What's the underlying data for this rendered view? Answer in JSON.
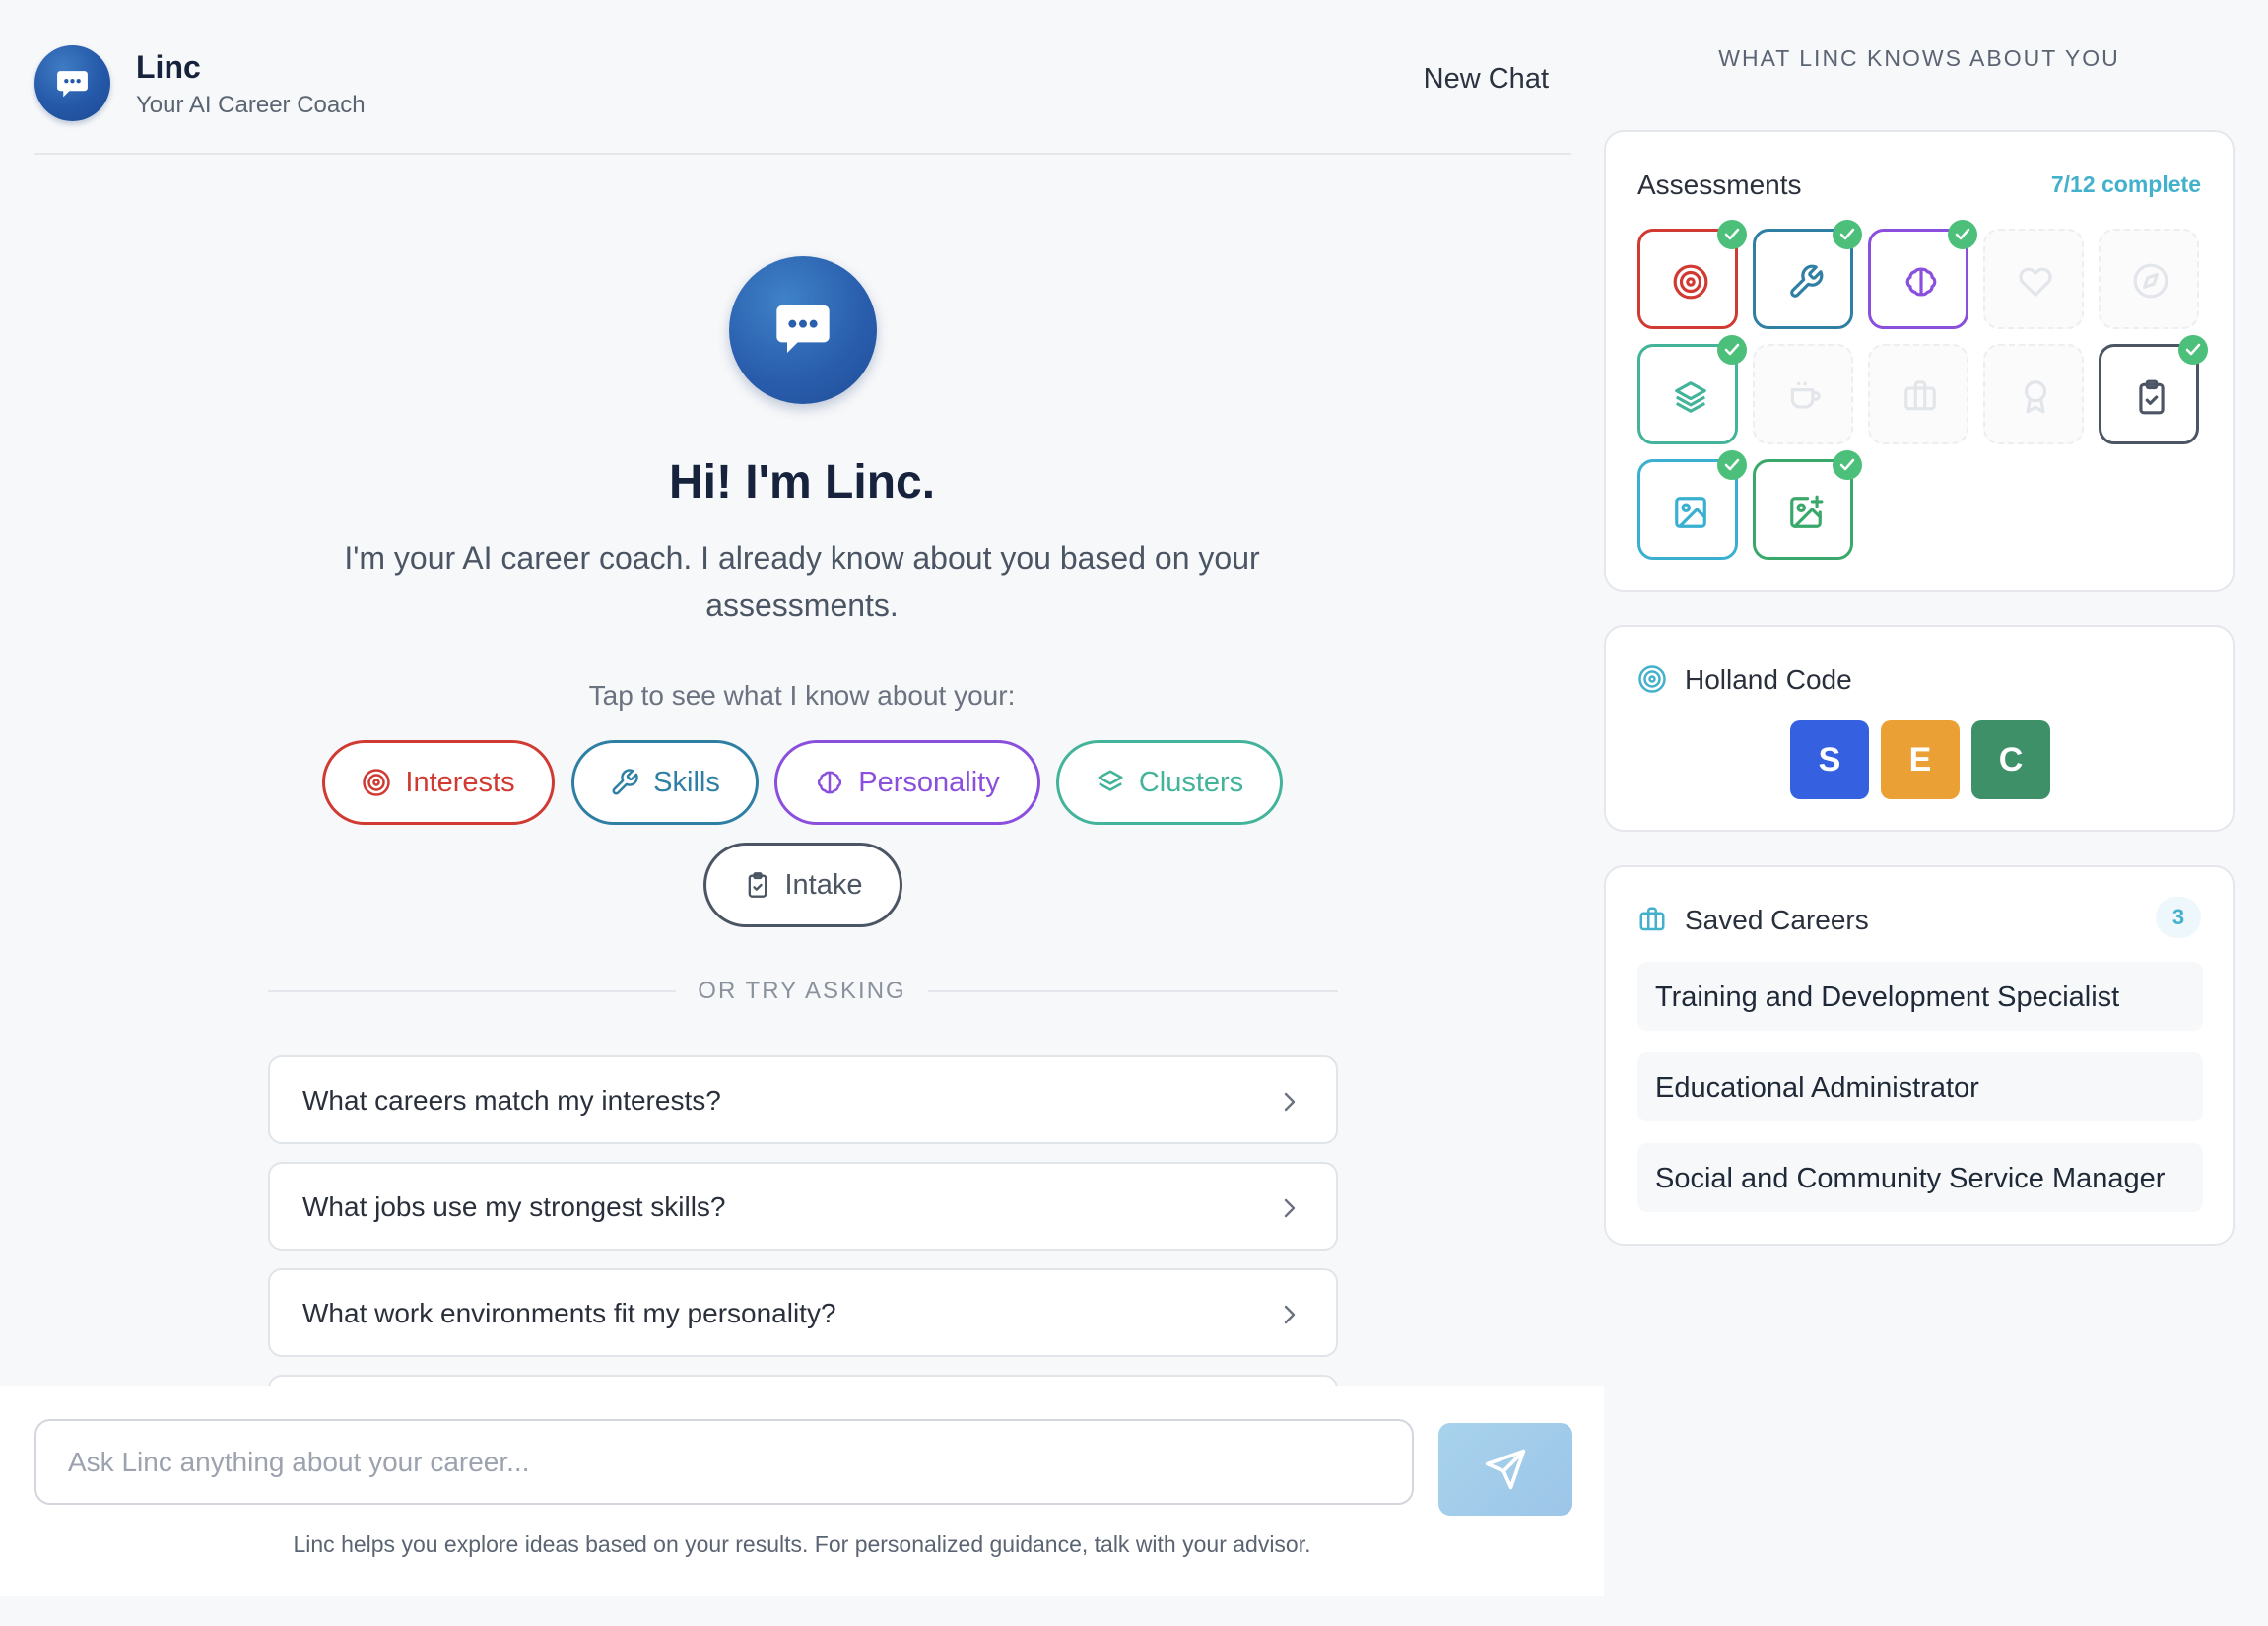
{
  "header": {
    "app_title": "Linc",
    "app_subtitle": "Your AI Career Coach",
    "new_chat_label": "New Chat"
  },
  "hero": {
    "title": "Hi! I'm Linc.",
    "intro": "I'm your AI career coach. I already know about you based on your assessments.",
    "tap_prompt": "Tap to see what I know about your:"
  },
  "topics": [
    {
      "label": "Interests",
      "icon": "target-icon",
      "color": "#d03a32"
    },
    {
      "label": "Skills",
      "icon": "wrench-icon",
      "color": "#2e7fa3"
    },
    {
      "label": "Personality",
      "icon": "brain-icon",
      "color": "#8a4fdc"
    },
    {
      "label": "Clusters",
      "icon": "layers-icon",
      "color": "#43b39a"
    },
    {
      "label": "Intake",
      "icon": "clipboard-check-icon",
      "color": "#4b5563"
    }
  ],
  "or_try_asking": "OR TRY ASKING",
  "suggestions": [
    "What careers match my interests?",
    "What jobs use my strongest skills?",
    "What work environments fit my personality?"
  ],
  "chat": {
    "placeholder": "Ask Linc anything about your career...",
    "send_icon": "send-icon",
    "disclaimer": "Linc helps you explore ideas based on your results. For personalized guidance, talk with your advisor."
  },
  "sidebar": {
    "heading": "WHAT LINC KNOWS ABOUT YOU",
    "assessments": {
      "title": "Assessments",
      "progress_text": "7/12 complete",
      "completed": 7,
      "total": 12,
      "tiles": [
        {
          "icon": "target-icon",
          "done": true,
          "color": "#d03a32"
        },
        {
          "icon": "wrench-icon",
          "done": true,
          "color": "#2e7fa3"
        },
        {
          "icon": "brain-icon",
          "done": true,
          "color": "#8a4fdc"
        },
        {
          "icon": "heart-icon",
          "done": false
        },
        {
          "icon": "compass-icon",
          "done": false
        },
        {
          "icon": "layers-icon",
          "done": true,
          "color": "#43b39a"
        },
        {
          "icon": "coffee-icon",
          "done": false
        },
        {
          "icon": "briefcase-icon",
          "done": false
        },
        {
          "icon": "award-icon",
          "done": false
        },
        {
          "icon": "clipboard-check-icon",
          "done": true,
          "color": "#4b5563"
        },
        {
          "icon": "image-icon",
          "done": true,
          "color": "#3ab0d0"
        },
        {
          "icon": "image-plus-icon",
          "done": true,
          "color": "#3aa86a"
        }
      ]
    },
    "holland": {
      "title": "Holland Code",
      "letters": [
        {
          "letter": "S",
          "color": "#3560e0"
        },
        {
          "letter": "E",
          "color": "#eba035"
        },
        {
          "letter": "C",
          "color": "#3d9068"
        }
      ]
    },
    "saved": {
      "title": "Saved Careers",
      "count": "3",
      "items": [
        "Training and Development Specialist",
        "Educational Administrator",
        "Social and Community Service Manager"
      ]
    }
  }
}
